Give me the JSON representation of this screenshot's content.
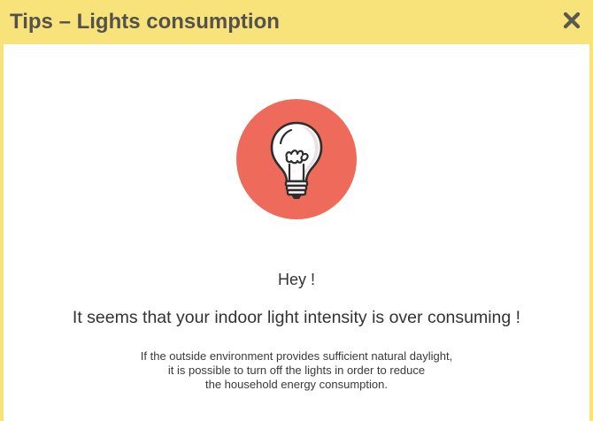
{
  "dialog": {
    "title": "Tips – Lights consumption",
    "close_icon": "close-icon",
    "accent_color": "#f8e27a",
    "icon_color": "#ee6a5b"
  },
  "content": {
    "icon": "lightbulb-icon",
    "greeting": "Hey !",
    "headline": "It seems that your indoor light intensity is over consuming !",
    "detail_lines": [
      "If the outside environment provides sufficient natural daylight,",
      "it is possible to turn off the lights in order to reduce",
      "the household energy consumption."
    ]
  }
}
